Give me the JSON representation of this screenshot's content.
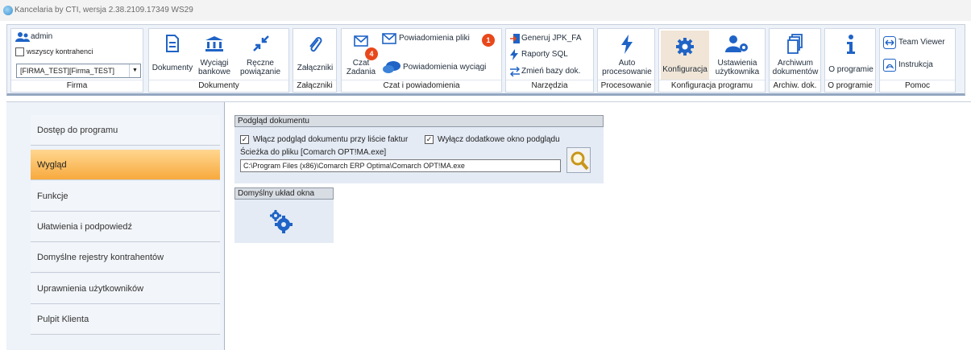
{
  "window": {
    "title": "Kancelaria by CTI, wersja  2.38.2109.17349 WS29"
  },
  "ribbon": {
    "firma": {
      "user": "admin",
      "checkbox_label": "wszyscy kontrahenci",
      "company_value": "[FIRMA_TEST][Firma_TEST]",
      "group_label": "Firma"
    },
    "dokumenty": {
      "btn_dokumenty": "Dokumenty",
      "btn_wyciagi_1": "Wyciągi",
      "btn_wyciagi_2": "bankowe",
      "btn_reczne_1": "Ręczne",
      "btn_reczne_2": "powiązanie",
      "group_label": "Dokumenty"
    },
    "zalaczniki": {
      "btn": "Załączniki",
      "group_label": "Załączniki"
    },
    "czat": {
      "btn_czat_1": "Czat",
      "btn_czat_2": "Zadania",
      "czat_badge": "4",
      "btn_powiadomienia_pliki": "Powiadomienia pliki",
      "pliki_badge": "1",
      "btn_powiadomienia_wyciagi": "Powiadomienia wyciągi",
      "group_label": "Czat i powiadomienia"
    },
    "narzedzia": {
      "btn_jpk": "Generuj JPK_FA",
      "btn_raporty": "Raporty SQL",
      "btn_zmien": "Zmień bazy dok.",
      "group_label": "Narzędzia"
    },
    "procesowanie": {
      "btn_1": "Auto",
      "btn_2": "procesowanie",
      "group_label": "Procesowanie"
    },
    "konfiguracja": {
      "btn_konfiguracja": "Konfiguracja",
      "btn_ustawienia_1": "Ustawienia",
      "btn_ustawienia_2": "użytkownika",
      "group_label": "Konfiguracja programu"
    },
    "archiwum": {
      "btn_1": "Archiwum",
      "btn_2": "dokumentów",
      "group_label": "Archiw. dok."
    },
    "oprogramie": {
      "btn": "O programie",
      "group_label": "O programie"
    },
    "pomoc": {
      "btn_teamviewer": "Team Viewer",
      "btn_instrukcja": "Instrukcja",
      "group_label": "Pomoc"
    }
  },
  "nav": {
    "items": [
      {
        "label": "Dostęp do programu"
      },
      {
        "label": "Wygląd"
      },
      {
        "label": "Funkcje"
      },
      {
        "label": "Ułatwienia i podpowiedź"
      },
      {
        "label": "Domyślne rejestry kontrahentów"
      },
      {
        "label": "Uprawnienia użytkowników"
      },
      {
        "label": "Pulpit Klienta"
      }
    ],
    "active_index": 1
  },
  "podglad": {
    "header": "Podgląd dokumentu",
    "cb1_label": "Włącz podgląd dokumentu przy liście faktur",
    "cb1_checked": true,
    "cb2_label": "Wyłącz dodatkowe okno podglądu",
    "cb2_checked": true,
    "path_label": "Ścieżka do pliku [Comarch OPT!MA.exe]",
    "path_value": "C:\\Program Files (x86)\\Comarch ERP Optima\\Comarch OPT!MA.exe"
  },
  "uklad": {
    "header": "Domyślny układ okna"
  },
  "colors": {
    "accent_orange": "#f7a93d",
    "ribbon_blue": "#1f63c6",
    "badge_red": "#e8481c"
  }
}
